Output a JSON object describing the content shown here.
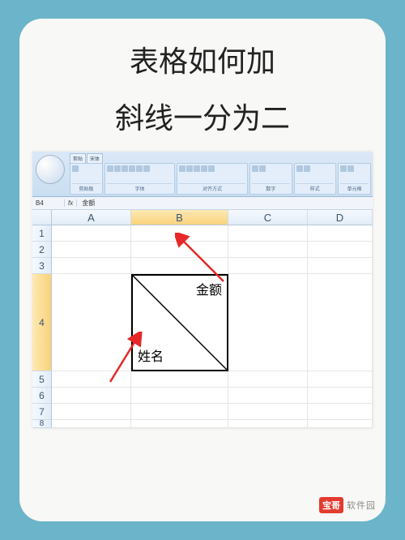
{
  "title_line_1": "表格如何加",
  "title_line_2": "斜线一分为二",
  "excel": {
    "cell_ref": "B4",
    "fx_label": "fx",
    "formula_value": "金额",
    "columns": [
      "A",
      "B",
      "C",
      "D"
    ],
    "rows": [
      "1",
      "2",
      "3",
      "4",
      "5",
      "6",
      "7",
      "8"
    ],
    "selected_col": "B",
    "merged": {
      "top_label": "金额",
      "bottom_label": "姓名"
    },
    "ribbon": {
      "tabs": [
        "剪贴",
        "宋体"
      ],
      "groups": [
        "剪贴板",
        "字体",
        "对齐方式",
        "数字",
        "样式",
        "单元格"
      ]
    }
  },
  "watermark": {
    "badge": "宝哥",
    "text": "软件园"
  },
  "colwidths": {
    "A": 98,
    "B": 120,
    "C": 98,
    "D": 80
  }
}
